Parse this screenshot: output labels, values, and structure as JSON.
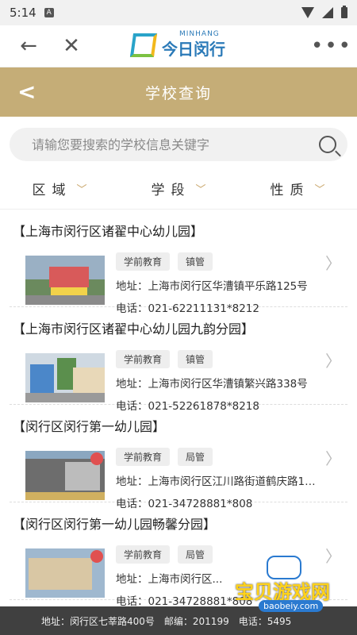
{
  "status": {
    "time": "5:14",
    "badge": "A"
  },
  "appbar": {
    "logo_small": "MINHANG",
    "logo_main": "今日闵行",
    "more": "•••"
  },
  "titlebar": {
    "title": "学校查询"
  },
  "search": {
    "placeholder": "请输您要搜索的学校信息关键字"
  },
  "filters": [
    {
      "label": "区域"
    },
    {
      "label": "学段"
    },
    {
      "label": "性质"
    }
  ],
  "schools": [
    {
      "name": "【上海市闵行区诸翟中心幼儿园】",
      "tags": [
        "学前教育",
        "镇管"
      ],
      "address": "地址：上海市闵行区华漕镇平乐路125号",
      "phone": "电话：021-62211131*8212"
    },
    {
      "name": "【上海市闵行区诸翟中心幼儿园九韵分园】",
      "tags": [
        "学前教育",
        "镇管"
      ],
      "address": "地址：上海市闵行区华漕镇繁兴路338号",
      "phone": "电话：021-52261878*8218"
    },
    {
      "name": "【闵行区闵行第一幼儿园】",
      "tags": [
        "学前教育",
        "局管"
      ],
      "address": "地址：上海市闵行区江川路街道鹤庆路1…",
      "phone": "电话：021-34728881*808"
    },
    {
      "name": "【闵行区闵行第一幼儿园畅馨分园】",
      "tags": [
        "学前教育",
        "局管"
      ],
      "address": "地址：上海市闵行区...",
      "phone": "电话：021-34728881*808"
    }
  ],
  "bottombar": {
    "address": "地址：闵行区七莘路400号",
    "postcode": "邮编：201199",
    "tel": "电话：5495"
  },
  "watermark": {
    "text": "宝贝游戏网",
    "url": "baobeiy.com"
  }
}
